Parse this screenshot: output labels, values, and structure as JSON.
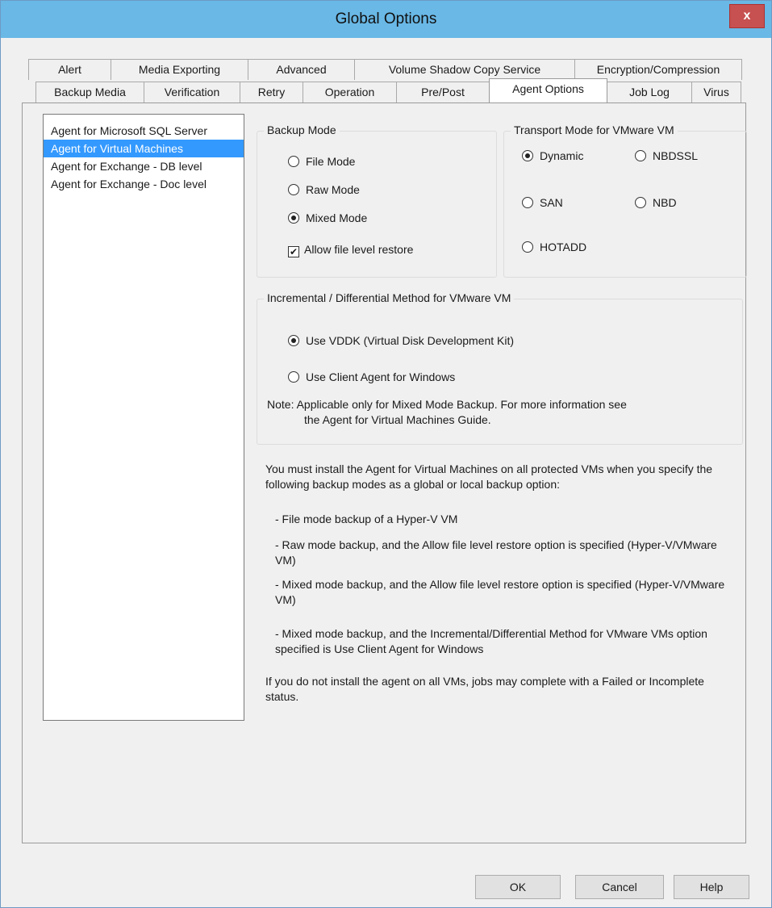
{
  "window": {
    "title": "Global Options",
    "close_label": "x"
  },
  "tabs_top": [
    "Alert",
    "Media Exporting",
    "Advanced",
    "Volume Shadow Copy Service",
    "Encryption/Compression"
  ],
  "tabs_bottom": [
    "Backup Media",
    "Verification",
    "Retry",
    "Operation",
    "Pre/Post",
    "Agent Options",
    "Job Log",
    "Virus"
  ],
  "active_tab": "Agent Options",
  "agents": {
    "items": [
      "Agent for Microsoft SQL Server",
      "Agent for Virtual Machines",
      "Agent for Exchange - DB level",
      "Agent for Exchange - Doc level"
    ],
    "selected": "Agent for Virtual Machines"
  },
  "backup_mode": {
    "label": "Backup Mode",
    "options": [
      "File Mode",
      "Raw Mode",
      "Mixed Mode"
    ],
    "selected": "Mixed Mode",
    "allow_restore_label": "Allow file level restore",
    "allow_restore_checked": true
  },
  "transport_mode": {
    "label": "Transport Mode for VMware VM",
    "options": [
      "Dynamic",
      "NBDSSL",
      "SAN",
      "NBD",
      "HOTADD"
    ],
    "selected": "Dynamic"
  },
  "incremental": {
    "label": "Incremental / Differential Method for VMware VM",
    "options": [
      "Use VDDK (Virtual Disk Development Kit)",
      "Use Client Agent for Windows"
    ],
    "selected": "Use VDDK (Virtual Disk Development Kit)",
    "note_line1": "Note: Applicable only for Mixed Mode Backup. For more information see",
    "note_line2": "the Agent for Virtual Machines Guide."
  },
  "info": {
    "intro": "You must install the Agent for Virtual Machines on all protected VMs when you specify the following backup modes as a global or local backup option:",
    "bullets": [
      "- File mode backup of a Hyper-V VM",
      "- Raw mode backup, and the Allow file level restore option is specified (Hyper-V/VMware VM)",
      "- Mixed mode backup, and the Allow file level restore option is specified (Hyper-V/VMware VM)",
      "- Mixed mode backup, and the Incremental/Differential Method for VMware VMs option specified is Use Client Agent for Windows"
    ],
    "footer": "If you do not install the agent on all VMs, jobs may complete with a Failed or Incomplete status."
  },
  "buttons": {
    "ok": "OK",
    "cancel": "Cancel",
    "help": "Help"
  }
}
